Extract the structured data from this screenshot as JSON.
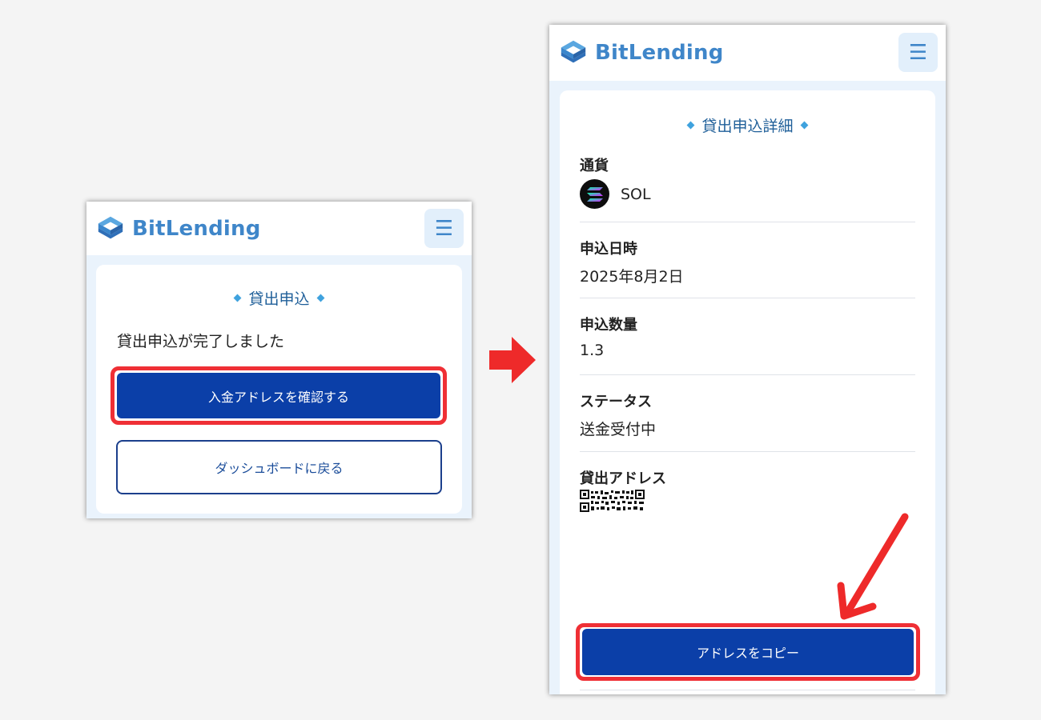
{
  "brand": {
    "name": "BitLending"
  },
  "menu_icon": "hamburger-menu-icon",
  "left_screen": {
    "section_title": "貸出申込",
    "message": "貸出申込が完了しました",
    "confirm_button": "入金アドレスを確認する",
    "back_button": "ダッシュボードに戻る"
  },
  "right_screen": {
    "section_title": "貸出申込詳細",
    "currency_label": "通貨",
    "currency_value": "SOL",
    "date_label": "申込日時",
    "date_value": "2025年8月2日",
    "amount_label": "申込数量",
    "amount_value": "1.3",
    "status_label": "ステータス",
    "status_value": "送金受付中",
    "address_label": "貸出アドレス",
    "copy_button": "アドレスをコピー"
  },
  "colors": {
    "primary_button": "#0b3fa8",
    "brand_blue": "#3f86c9",
    "highlight_red": "#ef2f35",
    "page_bg": "#f4f4f4"
  }
}
